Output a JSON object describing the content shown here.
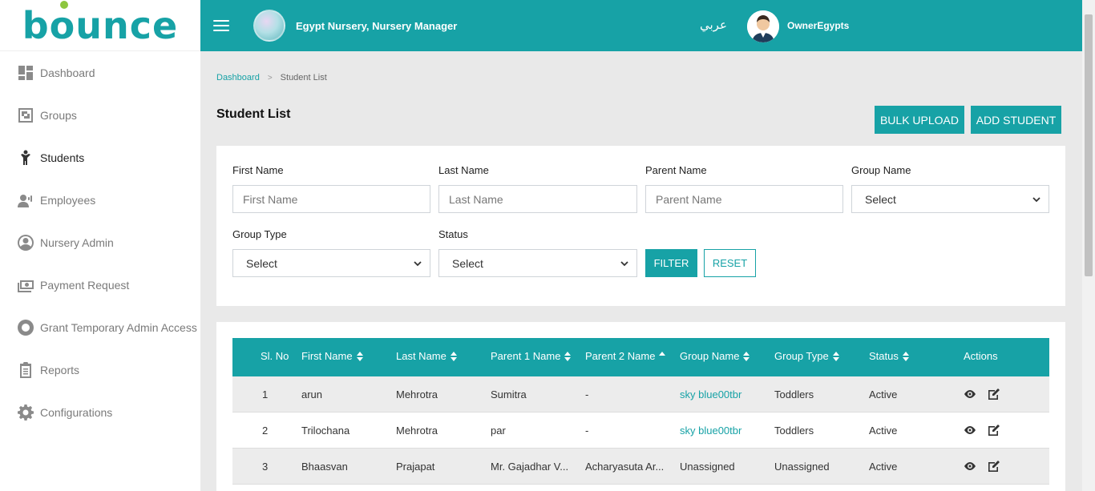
{
  "brand": {
    "logo_text": "bounce"
  },
  "sidebar": {
    "items": [
      {
        "label": "Dashboard",
        "icon": "dashboard-icon"
      },
      {
        "label": "Groups",
        "icon": "groups-icon"
      },
      {
        "label": "Students",
        "icon": "student-icon"
      },
      {
        "label": "Employees",
        "icon": "employees-icon"
      },
      {
        "label": "Nursery Admin",
        "icon": "user-circle-icon"
      },
      {
        "label": "Payment Request",
        "icon": "money-icon"
      },
      {
        "label": "Grant Temporary Admin Access",
        "icon": "lifebuoy-icon"
      },
      {
        "label": "Reports",
        "icon": "clipboard-icon"
      },
      {
        "label": "Configurations",
        "icon": "gear-icon"
      }
    ],
    "active": "Students"
  },
  "header": {
    "org_title": "Egypt Nursery, Nursery Manager",
    "language_toggle": "عربي",
    "username": "OwnerEgypts"
  },
  "breadcrumb": {
    "home": "Dashboard",
    "separator": ">",
    "current": "Student List"
  },
  "page": {
    "title": "Student List",
    "bulk_upload_label": "BULK UPLOAD",
    "add_student_label": "ADD STUDENT"
  },
  "filters": {
    "first_name": {
      "label": "First Name",
      "placeholder": "First Name"
    },
    "last_name": {
      "label": "Last Name",
      "placeholder": "Last Name"
    },
    "parent_name": {
      "label": "Parent Name",
      "placeholder": "Parent Name"
    },
    "group_name": {
      "label": "Group Name",
      "value": "Select"
    },
    "group_type": {
      "label": "Group Type",
      "value": "Select"
    },
    "status": {
      "label": "Status",
      "value": "Select"
    },
    "filter_label": "FILTER",
    "reset_label": "RESET"
  },
  "table": {
    "columns": [
      "Sl. No",
      "First Name",
      "Last Name",
      "Parent 1 Name",
      "Parent 2 Name",
      "Group Name",
      "Group Type",
      "Status",
      "Actions"
    ],
    "rows": [
      {
        "sl": "1",
        "first": "arun",
        "last": "Mehrotra",
        "parent1": "Sumitra",
        "parent2": "-",
        "group": "sky blue00tbr",
        "type": "Toddlers",
        "status": "Active"
      },
      {
        "sl": "2",
        "first": "Trilochana",
        "last": "Mehrotra",
        "parent1": "par",
        "parent2": "-",
        "group": "sky blue00tbr",
        "type": "Toddlers",
        "status": "Active"
      },
      {
        "sl": "3",
        "first": "Bhaasvan",
        "last": "Prajapat",
        "parent1": "Mr. Gajadhar V...",
        "parent2": "Acharyasuta Ar...",
        "group": "Unassigned",
        "type": "Unassigned",
        "status": "Active"
      }
    ]
  },
  "colors": {
    "accent": "#17a2a6",
    "content_bg": "#e9e9e9"
  }
}
